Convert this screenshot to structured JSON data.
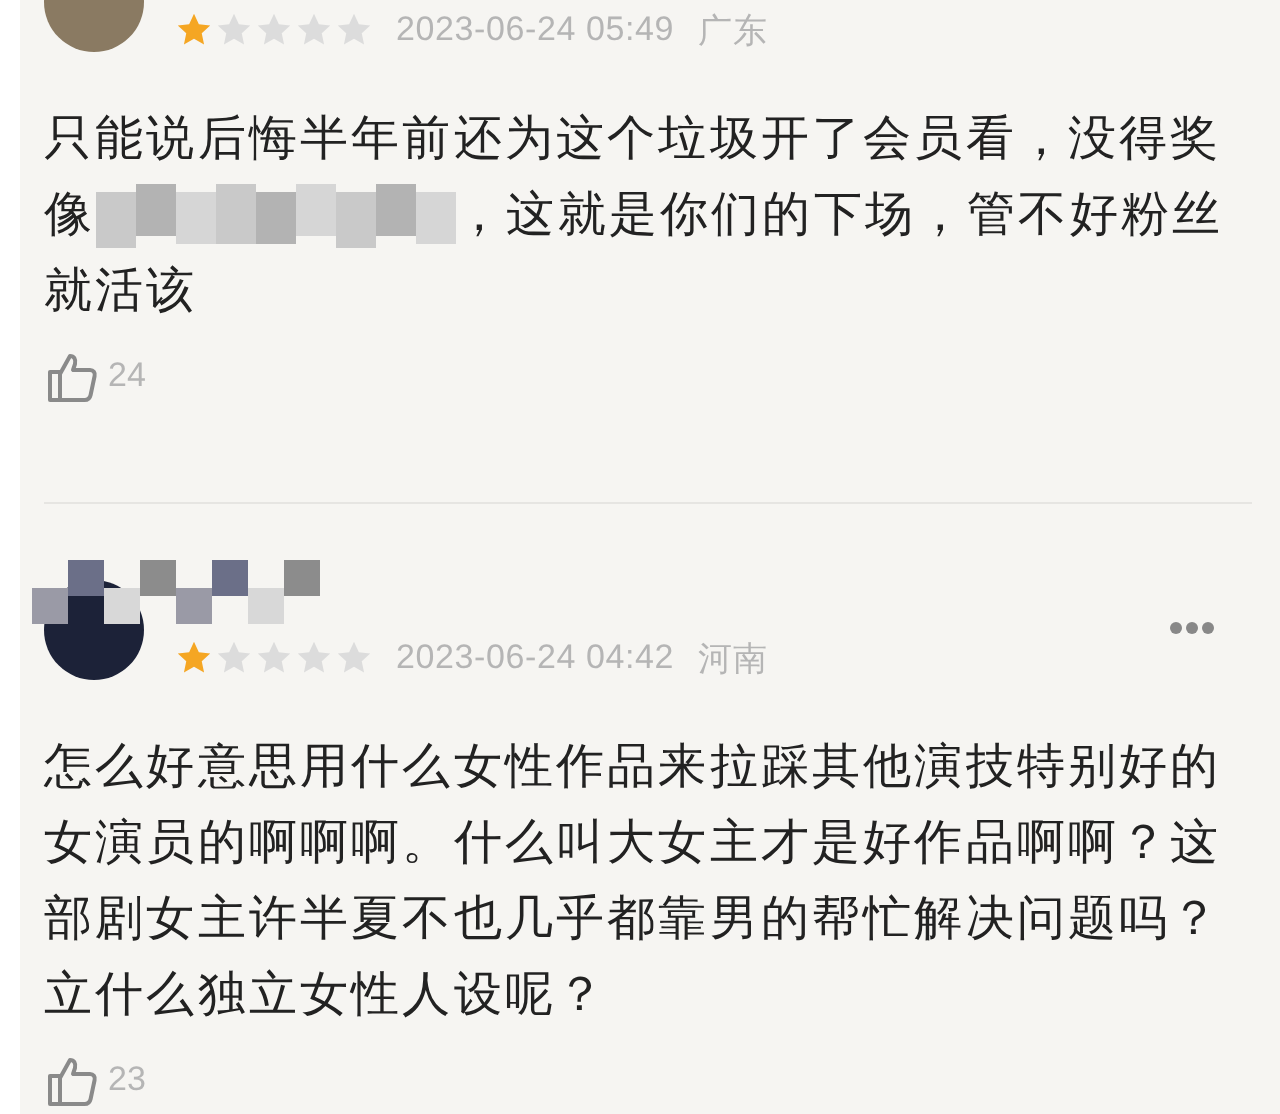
{
  "comments": [
    {
      "stars": 1,
      "date": "2023-06-24 05:49",
      "location": "广东",
      "lines": [
        [
          {
            "kind": "text",
            "text": "只能说后悔半年前还为这个垃圾开了会员看，没得奖"
          }
        ],
        [
          {
            "kind": "text",
            "text": "像"
          },
          {
            "kind": "blur"
          },
          {
            "kind": "text",
            "text": "，这就是你们的下场，管不好粉丝"
          }
        ],
        [
          {
            "kind": "text",
            "text": "就活该"
          }
        ]
      ],
      "likes": "24"
    },
    {
      "has_username": true,
      "has_more_button": true,
      "stars": 1,
      "date": "2023-06-24 04:42",
      "location": "河南",
      "lines": [
        [
          {
            "kind": "text",
            "text": "怎么好意思用什么女性作品来拉踩其他演技特别好的"
          }
        ],
        [
          {
            "kind": "text",
            "text": "女演员的啊啊啊。什么叫大女主才是好作品啊啊？这"
          }
        ],
        [
          {
            "kind": "text",
            "text": "部剧女主许半夏不也几乎都靠男的帮忙解决问题吗？"
          }
        ],
        [
          {
            "kind": "text",
            "text": "立什么独立女性人设呢？"
          }
        ]
      ],
      "likes": "23"
    }
  ]
}
